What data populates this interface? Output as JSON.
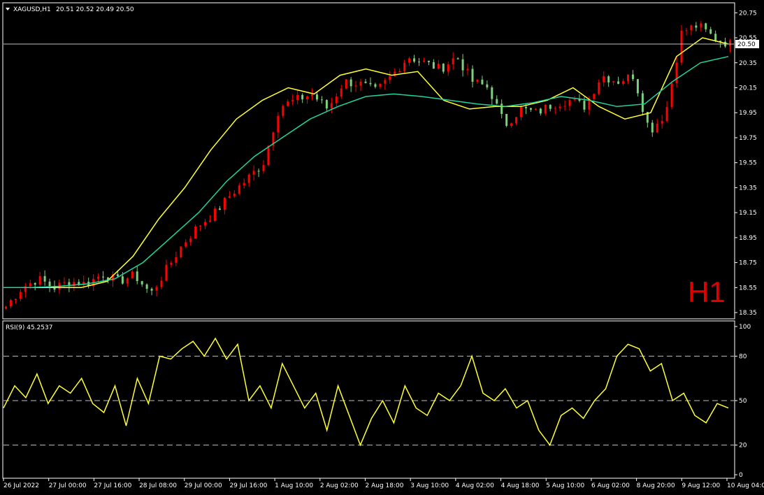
{
  "header": {
    "symbol_label": "XAGUSD,H1",
    "ohlc": "20.51 20.52 20.49 20.50",
    "dropdown_icon": "triangle-down-icon"
  },
  "watermark": {
    "timeframe": "H1",
    "color": "#e00000"
  },
  "current_price": {
    "value": 20.5,
    "label": "20.50"
  },
  "colors": {
    "background": "#000000",
    "bull_candle": "#ff0000",
    "bear_candle": "#7cd07c",
    "ma_fast": "#ffff33",
    "ma_slow": "#22d3a0",
    "rsi_line": "#ffff33",
    "frame": "#ffffff",
    "level_line": "#c0c0c0"
  },
  "chart_data": [
    {
      "type": "line",
      "panel": "main",
      "symbol": "XAGUSD",
      "timeframe": "H1",
      "ylim": [
        18.3,
        20.83
      ],
      "y_ticks": [
        {
          "value": 20.75,
          "label": "20.75"
        },
        {
          "value": 20.55,
          "label": "20.55"
        },
        {
          "value": 20.35,
          "label": "20.35"
        },
        {
          "value": 20.15,
          "label": "20.15"
        },
        {
          "value": 19.95,
          "label": "19.95"
        },
        {
          "value": 19.75,
          "label": "19.75"
        },
        {
          "value": 19.55,
          "label": "19.55"
        },
        {
          "value": 19.35,
          "label": "19.35"
        },
        {
          "value": 19.15,
          "label": "19.15"
        },
        {
          "value": 18.95,
          "label": "18.95"
        },
        {
          "value": 18.75,
          "label": "18.75"
        },
        {
          "value": 18.55,
          "label": "18.55"
        },
        {
          "value": 18.35,
          "label": "18.35"
        }
      ],
      "x_ticks": [
        "26 Jul 2022",
        "27 Jul 00:00",
        "27 Jul 16:00",
        "28 Jul 08:00",
        "29 Jul 00:00",
        "29 Jul 16:00",
        "1 Aug 10:00",
        "2 Aug 02:00",
        "2 Aug 18:00",
        "3 Aug 10:00",
        "4 Aug 02:00",
        "4 Aug 18:00",
        "5 Aug 10:00",
        "6 Aug 02:00",
        "8 Aug 20:00",
        "9 Aug 12:00",
        "10 Aug 04:00"
      ],
      "close_path": [
        18.4,
        18.55,
        18.62,
        18.55,
        18.6,
        18.58,
        18.66,
        18.6,
        18.65,
        18.5,
        18.7,
        18.9,
        19.05,
        19.15,
        19.3,
        19.42,
        19.55,
        20.0,
        20.05,
        20.1,
        19.98,
        20.2,
        20.18,
        20.12,
        20.25,
        20.4,
        20.35,
        20.3,
        20.4,
        20.2,
        20.15,
        19.85,
        19.98,
        19.95,
        20.02,
        20.05,
        20.0,
        20.25,
        20.2,
        20.25,
        19.8,
        19.95,
        20.6,
        20.65,
        20.55,
        20.5
      ],
      "series": [
        {
          "values": [
            18.55,
            18.55,
            18.55,
            18.55,
            18.6,
            18.8,
            19.1,
            19.35,
            19.65,
            19.9,
            20.05,
            20.15,
            20.1,
            20.25,
            20.3,
            20.25,
            20.28,
            20.05,
            19.98,
            20.0,
            20.0,
            20.05,
            20.15,
            20.0,
            19.9,
            19.95,
            20.4,
            20.55,
            20.5
          ]
        },
        {
          "values": [
            18.55,
            18.55,
            18.56,
            18.58,
            18.62,
            18.75,
            18.95,
            19.15,
            19.4,
            19.6,
            19.75,
            19.9,
            20.0,
            20.08,
            20.1,
            20.08,
            20.05,
            20.02,
            20.0,
            20.03,
            20.08,
            20.05,
            20.0,
            20.02,
            20.2,
            20.35,
            20.4
          ]
        }
      ]
    },
    {
      "type": "line",
      "panel": "rsi",
      "title": "RSI(9) 45.2537",
      "ylim": [
        0,
        100
      ],
      "levels": [
        80,
        50,
        20
      ],
      "y_ticks": [
        {
          "value": 100,
          "label": "100"
        },
        {
          "value": 80,
          "label": "80"
        },
        {
          "value": 50,
          "label": "50"
        },
        {
          "value": 20,
          "label": "20"
        },
        {
          "value": 0,
          "label": "0"
        }
      ],
      "series": [
        {
          "values": [
            45,
            60,
            52,
            68,
            48,
            60,
            55,
            65,
            48,
            42,
            60,
            33,
            65,
            48,
            80,
            78,
            85,
            90,
            80,
            92,
            78,
            88,
            50,
            60,
            45,
            75,
            60,
            45,
            55,
            30,
            60,
            40,
            20,
            38,
            50,
            35,
            60,
            45,
            40,
            55,
            50,
            60,
            80,
            55,
            50,
            58,
            45,
            50,
            30,
            20,
            40,
            45,
            38,
            50,
            58,
            80,
            88,
            85,
            70,
            75,
            50,
            55,
            40,
            35,
            48,
            45
          ]
        }
      ]
    }
  ]
}
